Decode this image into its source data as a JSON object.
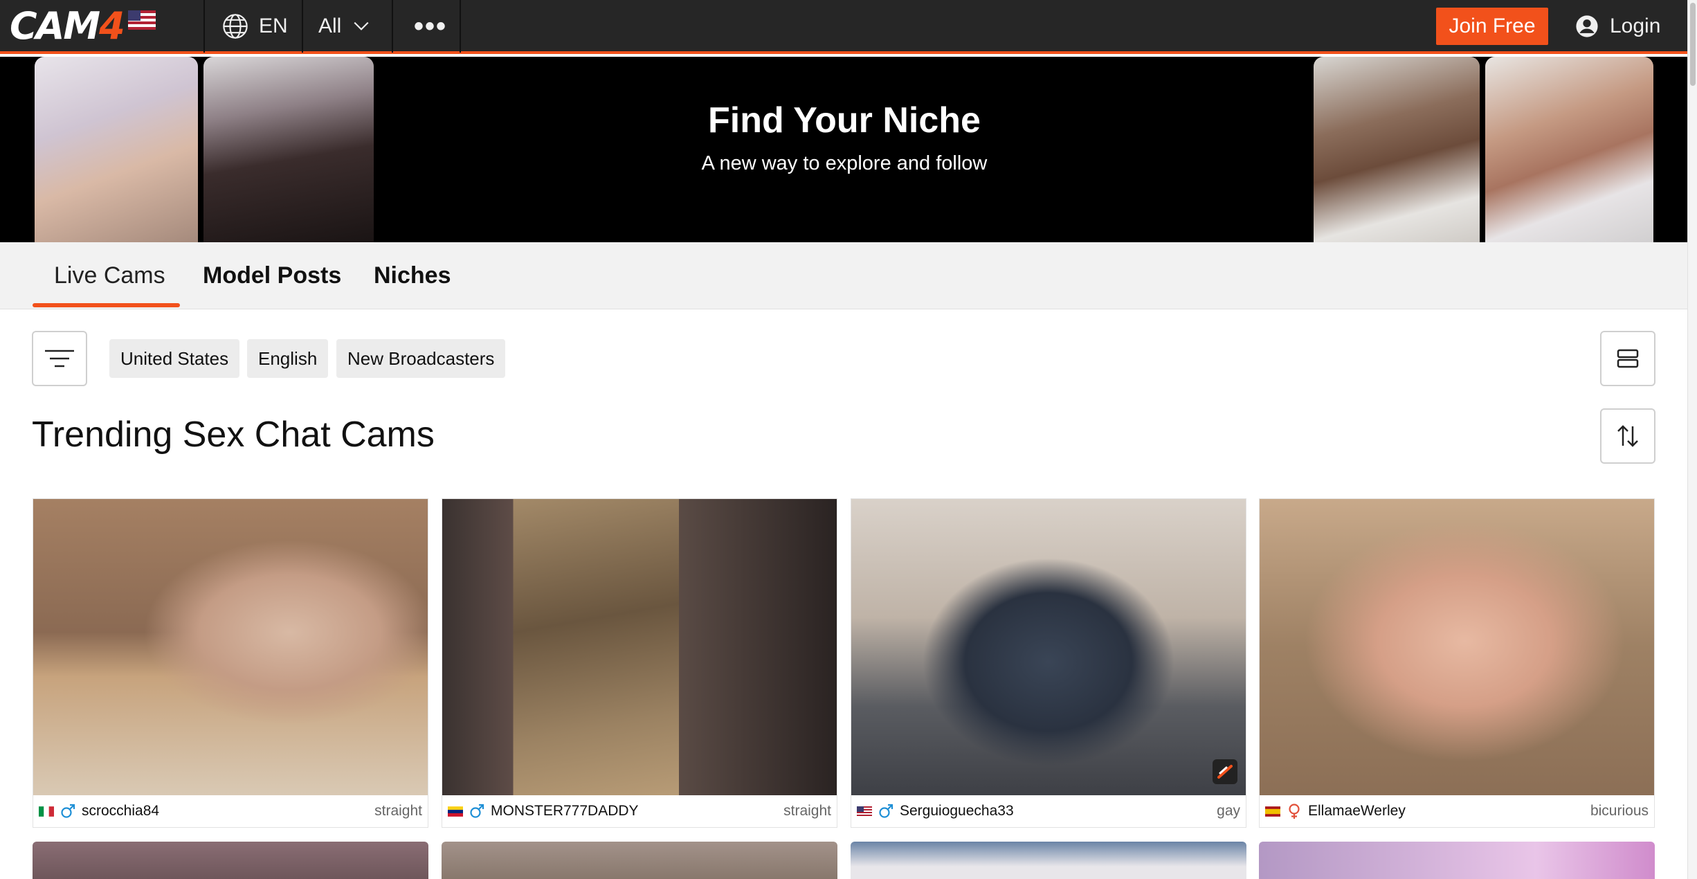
{
  "nav": {
    "logo_main": "CAM",
    "logo_accent": "4",
    "language": "EN",
    "filter_label": "All",
    "more_label": "•••",
    "join_label": "Join Free",
    "login_label": "Login",
    "accent_color": "#f2511b",
    "bar_color": "#262626"
  },
  "banner": {
    "title": "Find Your Niche",
    "subtitle": "A new way to explore and follow"
  },
  "tabs": [
    {
      "label": "Live Cams",
      "active": true
    },
    {
      "label": "Model Posts",
      "active": false
    },
    {
      "label": "Niches",
      "active": false
    }
  ],
  "filters": {
    "chips": [
      "United States",
      "English",
      "New Broadcasters"
    ]
  },
  "section": {
    "title": "Trending Sex Chat Cams"
  },
  "cams": [
    {
      "country": "Italy",
      "gender": "male",
      "name": "scrocchia84",
      "category": "straight"
    },
    {
      "country": "Venezuela",
      "gender": "male",
      "name": "MONSTER777DADDY",
      "category": "straight"
    },
    {
      "country": "United States",
      "gender": "male",
      "name": "Serguioguecha33",
      "category": "gay"
    },
    {
      "country": "Spain",
      "gender": "female",
      "name": "EllamaeWerley",
      "category": "bicurious"
    }
  ]
}
